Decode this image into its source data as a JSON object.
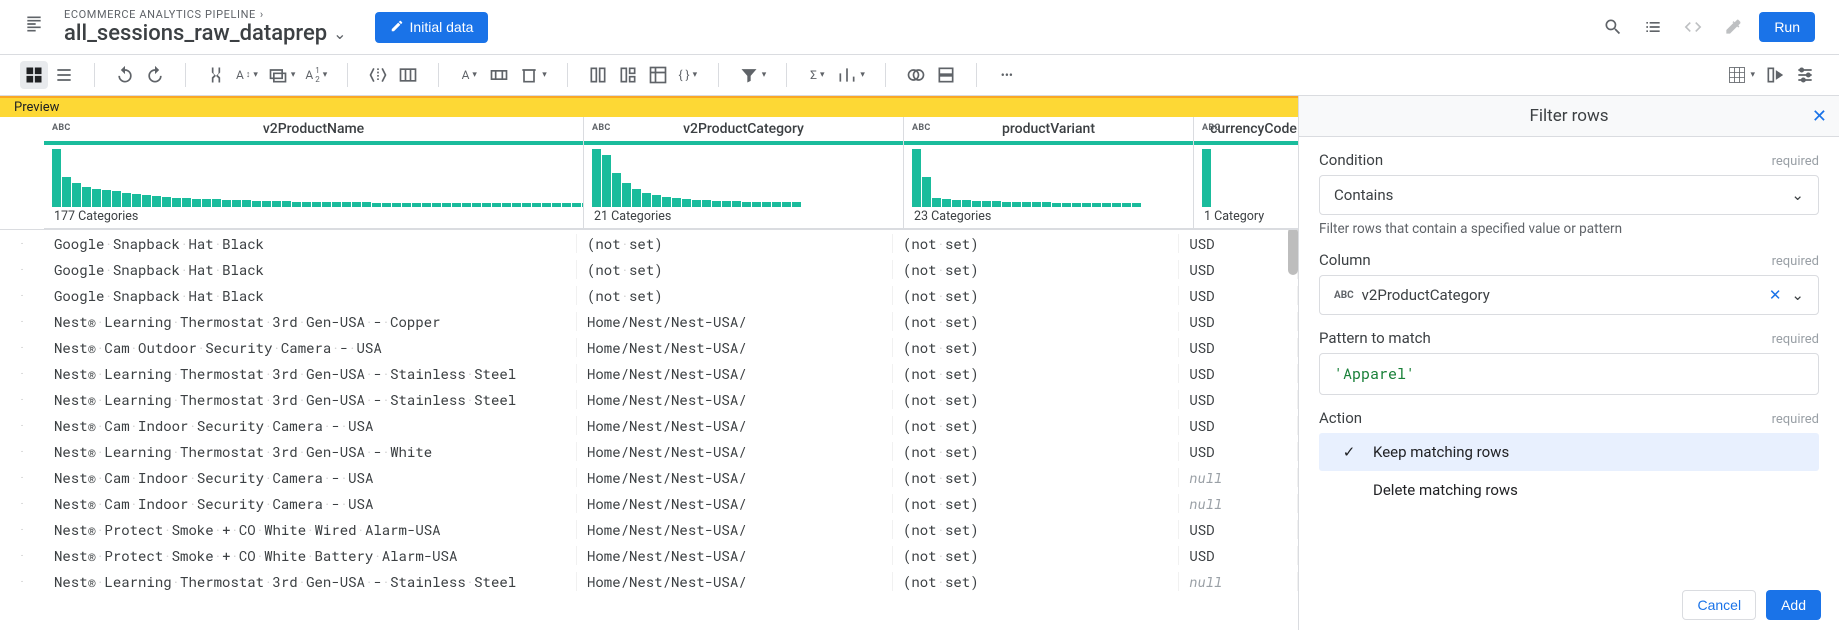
{
  "header": {
    "breadcrumb": "ECOMMERCE ANALYTICS PIPELINE",
    "title": "all_sessions_raw_dataprep",
    "initial_data_label": "Initial data",
    "run_label": "Run"
  },
  "preview_label": "Preview",
  "columns": [
    {
      "name": "v2ProductName",
      "type": "ABC",
      "hist_label": "177 Categories",
      "bars": [
        58,
        30,
        24,
        20,
        18,
        17,
        16,
        14,
        13,
        12,
        11,
        10,
        9,
        9,
        8,
        8,
        8,
        7,
        7,
        7,
        6,
        6,
        6,
        6,
        5,
        5,
        5,
        5,
        5,
        5,
        5,
        5,
        4,
        4,
        4,
        4,
        4,
        4,
        4,
        4,
        4,
        4,
        4,
        4,
        4,
        4,
        4,
        4,
        4,
        4,
        4,
        4,
        4,
        4,
        4
      ]
    },
    {
      "name": "v2ProductCategory",
      "type": "ABC",
      "hist_label": "21 Categories",
      "bars": [
        58,
        52,
        34,
        24,
        18,
        14,
        12,
        10,
        9,
        8,
        7,
        7,
        6,
        6,
        6,
        5,
        5,
        5,
        5,
        5,
        5
      ]
    },
    {
      "name": "productVariant",
      "type": "ABC",
      "hist_label": "23 Categories",
      "bars": [
        58,
        30,
        9,
        8,
        7,
        7,
        6,
        6,
        6,
        5,
        5,
        5,
        5,
        5,
        4,
        4,
        4,
        4,
        4,
        4,
        4,
        4,
        4
      ]
    },
    {
      "name": "currencyCode",
      "type": "ABC",
      "hist_label": "1 Category",
      "bars": [
        58
      ]
    }
  ],
  "rows": [
    {
      "c0": "Google·Snapback·Hat·Black",
      "c1": "(not·set)",
      "c2": "(not·set)",
      "c3": "USD"
    },
    {
      "c0": "Google·Snapback·Hat·Black",
      "c1": "(not·set)",
      "c2": "(not·set)",
      "c3": "USD"
    },
    {
      "c0": "Google·Snapback·Hat·Black",
      "c1": "(not·set)",
      "c2": "(not·set)",
      "c3": "USD"
    },
    {
      "c0": "Nest®·Learning·Thermostat·3rd·Gen-USA·-·Copper",
      "c1": "Home/Nest/Nest-USA/",
      "c2": "(not·set)",
      "c3": "USD"
    },
    {
      "c0": "Nest®·Cam·Outdoor·Security·Camera·-·USA",
      "c1": "Home/Nest/Nest-USA/",
      "c2": "(not·set)",
      "c3": "USD"
    },
    {
      "c0": "Nest®·Learning·Thermostat·3rd·Gen-USA·-·Stainless·Steel",
      "c1": "Home/Nest/Nest-USA/",
      "c2": "(not·set)",
      "c3": "USD"
    },
    {
      "c0": "Nest®·Learning·Thermostat·3rd·Gen-USA·-·Stainless·Steel",
      "c1": "Home/Nest/Nest-USA/",
      "c2": "(not·set)",
      "c3": "USD"
    },
    {
      "c0": "Nest®·Cam·Indoor·Security·Camera·-·USA",
      "c1": "Home/Nest/Nest-USA/",
      "c2": "(not·set)",
      "c3": "USD"
    },
    {
      "c0": "Nest®·Learning·Thermostat·3rd·Gen-USA·-·White",
      "c1": "Home/Nest/Nest-USA/",
      "c2": "(not·set)",
      "c3": "USD"
    },
    {
      "c0": "Nest®·Cam·Indoor·Security·Camera·-·USA",
      "c1": "Home/Nest/Nest-USA/",
      "c2": "(not·set)",
      "c3": "null",
      "null3": true
    },
    {
      "c0": "Nest®·Cam·Indoor·Security·Camera·-·USA",
      "c1": "Home/Nest/Nest-USA/",
      "c2": "(not·set)",
      "c3": "null",
      "null3": true
    },
    {
      "c0": "Nest®·Protect·Smoke·+·CO·White·Wired·Alarm-USA",
      "c1": "Home/Nest/Nest-USA/",
      "c2": "(not·set)",
      "c3": "USD"
    },
    {
      "c0": "Nest®·Protect·Smoke·+·CO·White·Battery·Alarm-USA",
      "c1": "Home/Nest/Nest-USA/",
      "c2": "(not·set)",
      "c3": "USD"
    },
    {
      "c0": "Nest®·Learning·Thermostat·3rd·Gen-USA·-·Stainless·Steel",
      "c1": "Home/Nest/Nest-USA/",
      "c2": "(not·set)",
      "c3": "null",
      "null3": true
    }
  ],
  "panel": {
    "title": "Filter rows",
    "condition": {
      "label": "Condition",
      "required": "required",
      "value": "Contains",
      "hint": "Filter rows that contain a specified value or pattern"
    },
    "column": {
      "label": "Column",
      "required": "required",
      "type_badge": "ABC",
      "value": "v2ProductCategory"
    },
    "pattern": {
      "label": "Pattern to match",
      "required": "required",
      "value": "'Apparel'"
    },
    "action": {
      "label": "Action",
      "required": "required",
      "options": [
        "Keep matching rows",
        "Delete matching rows"
      ],
      "selected": 0
    },
    "footer": {
      "cancel": "Cancel",
      "add": "Add"
    }
  }
}
